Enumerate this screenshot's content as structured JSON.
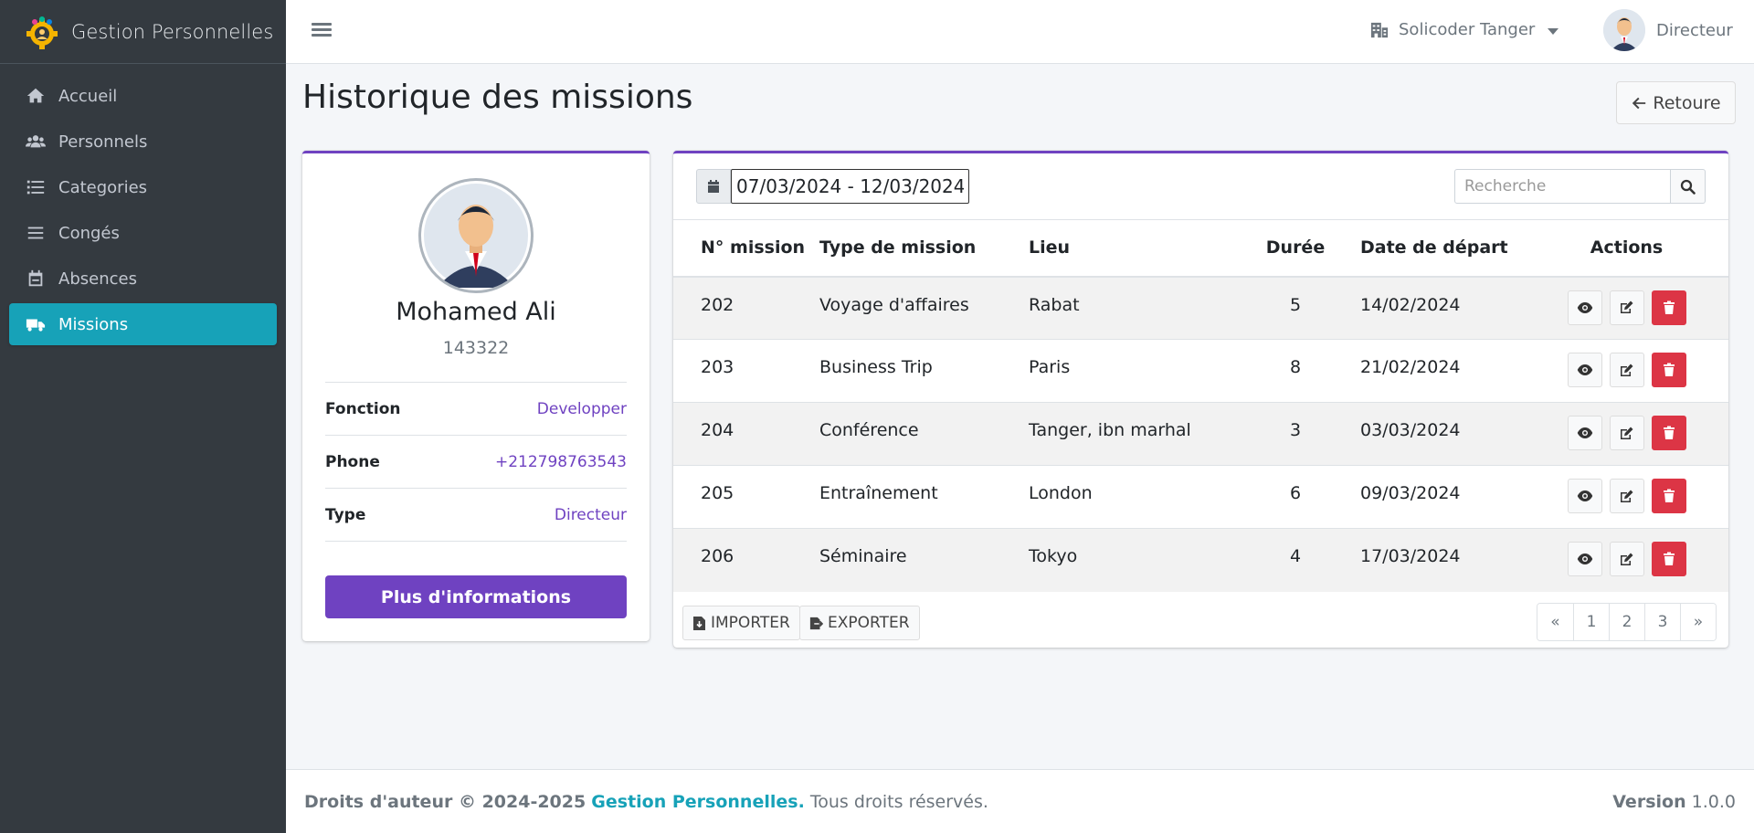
{
  "sidebar": {
    "brand": "Gestion Personnelles",
    "items": [
      {
        "label": "Accueil",
        "icon": "home-icon"
      },
      {
        "label": "Personnels",
        "icon": "users-icon"
      },
      {
        "label": "Categories",
        "icon": "list-icon"
      },
      {
        "label": "Congés",
        "icon": "bars-icon"
      },
      {
        "label": "Absences",
        "icon": "calendar-icon"
      },
      {
        "label": "Missions",
        "icon": "truck-icon",
        "active": true
      }
    ]
  },
  "header": {
    "company": "Solicoder Tanger",
    "user_role": "Directeur"
  },
  "page": {
    "title": "Historique des missions",
    "back_label": "Retoure"
  },
  "profile": {
    "name": "Mohamed Ali",
    "id": "143322",
    "rows": [
      {
        "key": "Fonction",
        "value": "Developper"
      },
      {
        "key": "Phone",
        "value": "+212798763543"
      },
      {
        "key": "Type",
        "value": "Directeur"
      }
    ],
    "more_label": "Plus d'informations"
  },
  "table": {
    "date_range": "07/03/2024 - 12/03/2024",
    "search_placeholder": "Recherche",
    "headers": [
      "N° mission",
      "Type de mission",
      "Lieu",
      "Durée",
      "Date de départ",
      "Actions"
    ],
    "rows": [
      {
        "num": "202",
        "type": "Voyage d'affaires",
        "lieu": "Rabat",
        "duree": "5",
        "date": "14/02/2024"
      },
      {
        "num": "203",
        "type": "Business Trip",
        "lieu": "Paris",
        "duree": "8",
        "date": "21/02/2024"
      },
      {
        "num": "204",
        "type": "Conférence",
        "lieu": "Tanger, ibn marhal",
        "duree": "3",
        "date": "03/03/2024"
      },
      {
        "num": "205",
        "type": "Entraînement",
        "lieu": "London",
        "duree": "6",
        "date": "09/03/2024"
      },
      {
        "num": "206",
        "type": "Séminaire",
        "lieu": "Tokyo",
        "duree": "4",
        "date": "17/03/2024"
      }
    ],
    "import_label": "IMPORTER",
    "export_label": "EXPORTER",
    "pagination": [
      "«",
      "1",
      "2",
      "3",
      "»"
    ]
  },
  "footer": {
    "copyright": "Droits d'auteur © 2024-2025",
    "brand": "Gestion Personnelles.",
    "rights": "Tous droits réservés.",
    "version_label": "Version",
    "version": "1.0.0"
  },
  "colors": {
    "sidebar_bg": "#343a40",
    "active_item": "#17a2b8",
    "accent": "#6f42c1",
    "danger": "#dc3545"
  }
}
